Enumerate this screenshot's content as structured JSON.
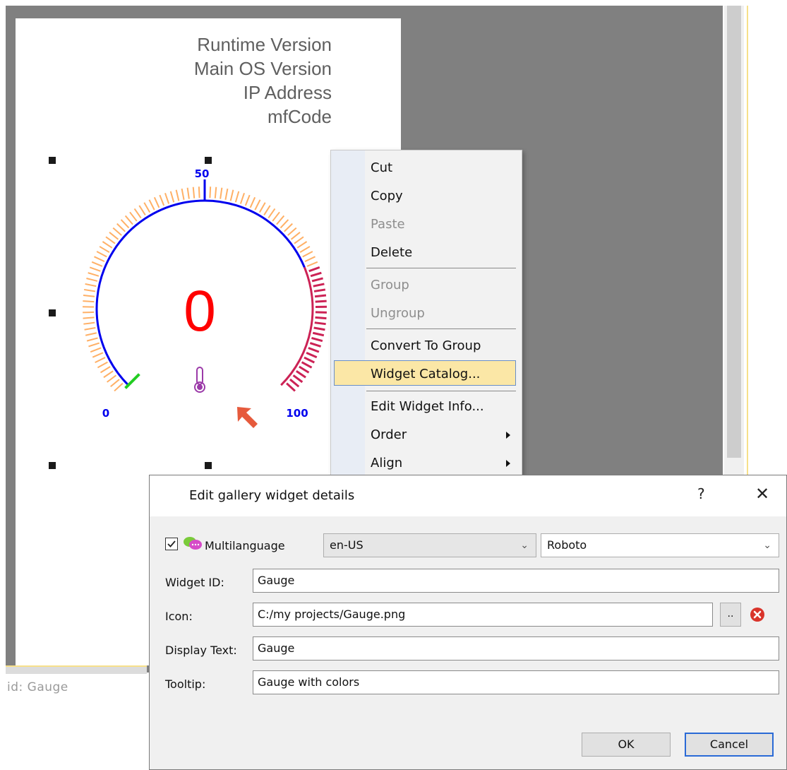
{
  "canvas": {
    "info_lines": [
      "Runtime Version",
      "Main OS Version",
      "IP Address",
      "mfCode"
    ],
    "status_id_text": "id: Gauge"
  },
  "gauge": {
    "value": "0",
    "min_label": "0",
    "mid_label": "50",
    "max_label": "100",
    "colors": {
      "arc": "#0000ee",
      "ticks": "#ffb066",
      "value": "#ff0000",
      "low": "#22cc22",
      "high": "#cc2255",
      "icon": "#9b3aa8"
    }
  },
  "context_menu": {
    "items": [
      {
        "label": "Cut",
        "enabled": true
      },
      {
        "label": "Copy",
        "enabled": true
      },
      {
        "label": "Paste",
        "enabled": false
      },
      {
        "label": "Delete",
        "enabled": true
      },
      {
        "label": "Group",
        "enabled": false
      },
      {
        "label": "Ungroup",
        "enabled": false
      },
      {
        "label": "Convert To Group",
        "enabled": true
      },
      {
        "label": "Widget Catalog...",
        "enabled": true,
        "highlighted": true
      },
      {
        "label": "Edit Widget Info...",
        "enabled": true
      },
      {
        "label": "Order",
        "enabled": true,
        "submenu": true
      },
      {
        "label": "Align",
        "enabled": true,
        "submenu": true
      }
    ]
  },
  "dialog": {
    "title": "Edit gallery widget details",
    "help": "?",
    "close": "✕",
    "multilanguage_label": "Multilanguage",
    "multilanguage_checked": true,
    "language": "en-US",
    "font": "Roboto",
    "widget_id_label": "Widget ID:",
    "widget_id_value": "Gauge",
    "icon_label": "Icon:",
    "icon_value": "C:/my projects/Gauge.png",
    "browse_label": "..",
    "display_text_label": "Display Text:",
    "display_text_value": "Gauge",
    "tooltip_label": "Tooltip:",
    "tooltip_value": "Gauge with colors",
    "ok_label": "OK",
    "cancel_label": "Cancel"
  }
}
